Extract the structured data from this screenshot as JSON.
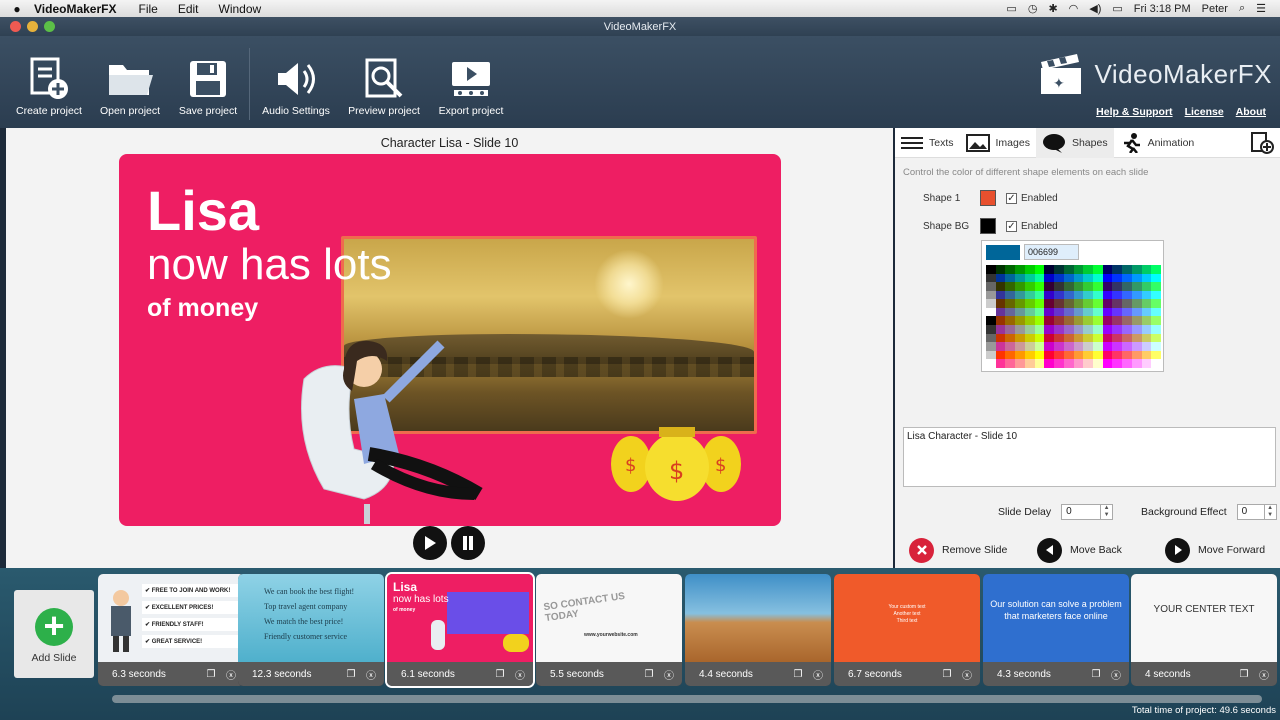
{
  "menubar": {
    "app_name": "VideoMakerFX",
    "items": [
      "File",
      "Edit",
      "Window"
    ],
    "clock": "Fri 3:18 PM",
    "user": "Peter"
  },
  "window": {
    "title": "VideoMakerFX"
  },
  "toolbar": {
    "buttons": [
      {
        "label": "Create project",
        "icon": "create-project-icon"
      },
      {
        "label": "Open project",
        "icon": "folder-icon"
      },
      {
        "label": "Save project",
        "icon": "floppy-icon"
      },
      {
        "label": "Audio Settings",
        "icon": "speaker-icon"
      },
      {
        "label": "Preview project",
        "icon": "preview-icon"
      },
      {
        "label": "Export project",
        "icon": "export-icon"
      }
    ],
    "brand": "VideoMakerFX",
    "links": [
      "Help & Support",
      "License",
      "About"
    ]
  },
  "canvas": {
    "slide_title": "Character Lisa - Slide 10",
    "slide": {
      "line1": "Lisa",
      "line2": "now has lots",
      "line3": "of money",
      "bag_symbol": "$"
    }
  },
  "panel": {
    "tabs": [
      {
        "label": "Texts",
        "icon": "text-lines-icon"
      },
      {
        "label": "Images",
        "icon": "image-icon"
      },
      {
        "label": "Shapes",
        "icon": "speech-bubble-icon"
      },
      {
        "label": "Animation",
        "icon": "running-man-icon"
      }
    ],
    "active_tab": "Shapes",
    "hint": "Control the color of different shape elements on each slide",
    "shapes": [
      {
        "label": "Shape 1",
        "color": "#e8502e",
        "enabled_label": "Enabled",
        "enabled": true
      },
      {
        "label": "Shape BG",
        "color": "#000000",
        "enabled_label": "Enabled",
        "enabled": true
      }
    ],
    "picker": {
      "hex": "006699",
      "color": "#006699"
    },
    "description": "Lisa Character - Slide 10",
    "slide_delay": {
      "label": "Slide Delay",
      "value": "0"
    },
    "background_effect": {
      "label": "Background Effect",
      "value": "0"
    },
    "actions": [
      {
        "label": "Remove Slide",
        "icon": "remove-icon"
      },
      {
        "label": "Move Back",
        "icon": "arrow-left-icon"
      },
      {
        "label": "Move Forward",
        "icon": "arrow-right-icon"
      }
    ]
  },
  "timeline": {
    "add_label": "Add Slide",
    "slides": [
      {
        "duration": "6.3 seconds",
        "kind": "checklist",
        "lines": [
          "FREE TO JOIN AND WORK!",
          "EXCELLENT PRICES!",
          "FRIENDLY STAFF!",
          "GREAT SERVICE!"
        ]
      },
      {
        "duration": "12.3 seconds",
        "kind": "travel",
        "lines": [
          "We can book the best flight!",
          "Top travel agent company",
          "We match the best price!",
          "Friendly customer service"
        ]
      },
      {
        "duration": "6.1 seconds",
        "kind": "lisa",
        "lines": [
          "Lisa",
          "now has lots",
          "of money"
        ]
      },
      {
        "duration": "5.5 seconds",
        "kind": "contact",
        "lines": [
          "SO CONTACT US TODAY",
          "www.yourwebsite.com"
        ]
      },
      {
        "duration": "4.4 seconds",
        "kind": "desert",
        "lines": []
      },
      {
        "duration": "6.7 seconds",
        "kind": "orange",
        "lines": [
          "Your custom text",
          "Another text",
          "Third text"
        ]
      },
      {
        "duration": "4.3 seconds",
        "kind": "blue",
        "lines": [
          "Our solution can solve a problem that marketers face online"
        ]
      },
      {
        "duration": "4 seconds",
        "kind": "white",
        "lines": [
          "YOUR CENTER TEXT"
        ]
      }
    ],
    "selected_index": 2,
    "total": "Total time of project: 49.6 seconds"
  }
}
